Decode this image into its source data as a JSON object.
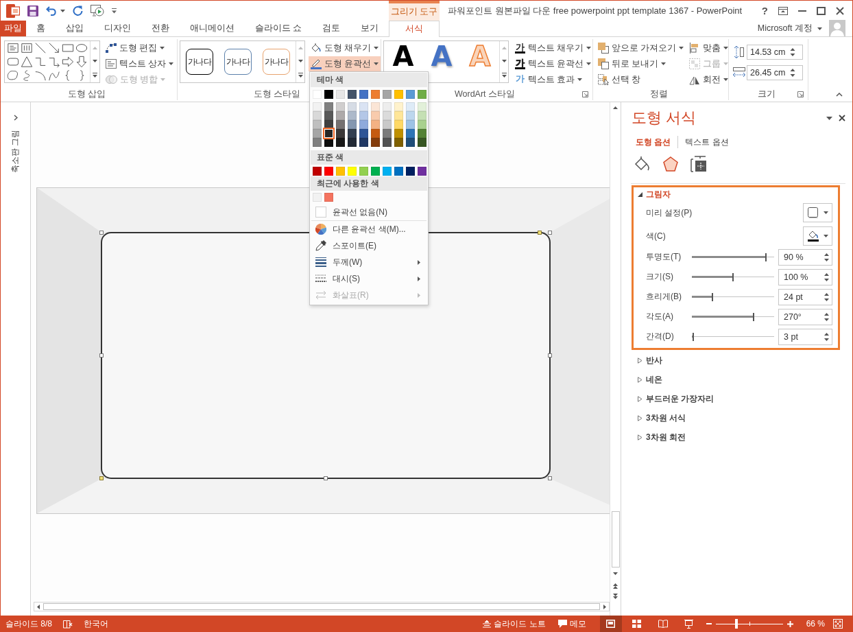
{
  "title_bar": {
    "context_label": "그리기 도구",
    "title": "파워포인트 원본파일 다운 free powerpoint ppt template 1367 - PowerPoint",
    "help": "?"
  },
  "tabs": [
    {
      "label": "파일",
      "kind": "file",
      "selected": false
    },
    {
      "label": "홈",
      "kind": "normal",
      "selected": false
    },
    {
      "label": "삽입",
      "kind": "normal",
      "selected": false
    },
    {
      "label": "디자인",
      "kind": "normal",
      "selected": false
    },
    {
      "label": "전환",
      "kind": "normal",
      "selected": false
    },
    {
      "label": "애니메이션",
      "kind": "normal",
      "selected": false
    },
    {
      "label": "슬라이드 쇼",
      "kind": "normal",
      "selected": false
    },
    {
      "label": "검토",
      "kind": "normal",
      "selected": false
    },
    {
      "label": "보기",
      "kind": "normal",
      "selected": false
    },
    {
      "label": "서식",
      "kind": "contextual",
      "selected": true
    }
  ],
  "account": {
    "label": "Microsoft 계정"
  },
  "ribbon": {
    "shape_insert": {
      "label": "도형 삽입",
      "commands": [
        {
          "label": "도형 편집",
          "disabled": false
        },
        {
          "label": "텍스트 상자",
          "disabled": false
        },
        {
          "label": "도형 병합",
          "disabled": true
        }
      ]
    },
    "shape_styles": {
      "label": "도형 스타일",
      "samples": [
        {
          "text": "가나다",
          "color": "#000000"
        },
        {
          "text": "가나다",
          "color": "#5b80ab"
        },
        {
          "text": "가나다",
          "color": "#e8a36e"
        }
      ],
      "commands": [
        {
          "label": "도형 채우기",
          "expanded": false
        },
        {
          "label": "도형 윤곽선",
          "expanded": true
        }
      ]
    },
    "wordart_styles": {
      "label": "WordArt 스타일",
      "samples": [
        {
          "text": "A",
          "kind": "solid",
          "color": "#000000"
        },
        {
          "text": "A",
          "kind": "shadow",
          "color": "#4472c4"
        },
        {
          "text": "A",
          "kind": "outline",
          "color": "#ed7d31"
        }
      ],
      "commands": [
        {
          "label": "텍스트 채우기",
          "icon_text": "가"
        },
        {
          "label": "텍스트 윤곽선",
          "icon_text": "가"
        },
        {
          "label": "텍스트 효과",
          "icon_text": "가"
        }
      ]
    },
    "arrange": {
      "label": "정렬",
      "commands": [
        {
          "label": "앞으로 가져오기",
          "kind": "dropdown",
          "disabled": false
        },
        {
          "label": "뒤로 보내기",
          "kind": "dropdown",
          "disabled": false
        },
        {
          "label": "선택 창",
          "kind": "button",
          "disabled": false
        },
        {
          "label": "맞춤",
          "kind": "dropdown",
          "disabled": false
        },
        {
          "label": "그룹",
          "kind": "dropdown",
          "disabled": true
        },
        {
          "label": "회전",
          "kind": "dropdown",
          "disabled": false
        }
      ]
    },
    "size": {
      "label": "크기",
      "height": "14.53 cm",
      "width": "26.45 cm"
    }
  },
  "color_menu": {
    "theme_header": "테마 색",
    "theme_colors": [
      {
        "color": "#ffffff",
        "selected": false,
        "shades": [
          {
            "color": "#f2f2f2",
            "selected": false
          },
          {
            "color": "#d9d9d9",
            "selected": false
          },
          {
            "color": "#bfbfbf",
            "selected": false
          },
          {
            "color": "#a6a6a6",
            "selected": false
          },
          {
            "color": "#808080",
            "selected": false
          }
        ]
      },
      {
        "color": "#000000",
        "selected": false,
        "shades": [
          {
            "color": "#808080",
            "selected": false
          },
          {
            "color": "#595959",
            "selected": false
          },
          {
            "color": "#404040",
            "selected": false
          },
          {
            "color": "#262626",
            "selected": true
          },
          {
            "color": "#0d0d0d",
            "selected": false
          }
        ]
      },
      {
        "color": "#e7e6e6",
        "selected": false,
        "shades": [
          {
            "color": "#d0cece",
            "selected": false
          },
          {
            "color": "#aeaaaa",
            "selected": false
          },
          {
            "color": "#757171",
            "selected": false
          },
          {
            "color": "#3b3838",
            "selected": false
          },
          {
            "color": "#171717",
            "selected": false
          }
        ]
      },
      {
        "color": "#44546a",
        "selected": false,
        "shades": [
          {
            "color": "#d6dce5",
            "selected": false
          },
          {
            "color": "#adb9ca",
            "selected": false
          },
          {
            "color": "#8497b0",
            "selected": false
          },
          {
            "color": "#333f50",
            "selected": false
          },
          {
            "color": "#222a35",
            "selected": false
          }
        ]
      },
      {
        "color": "#4472c4",
        "selected": false,
        "shades": [
          {
            "color": "#dae3f3",
            "selected": false
          },
          {
            "color": "#b4c7e7",
            "selected": false
          },
          {
            "color": "#8faadc",
            "selected": false
          },
          {
            "color": "#2f5597",
            "selected": false
          },
          {
            "color": "#203864",
            "selected": false
          }
        ]
      },
      {
        "color": "#ed7d31",
        "selected": false,
        "shades": [
          {
            "color": "#fbe5d6",
            "selected": false
          },
          {
            "color": "#f8cbad",
            "selected": false
          },
          {
            "color": "#f4b183",
            "selected": false
          },
          {
            "color": "#c55a11",
            "selected": false
          },
          {
            "color": "#843c0c",
            "selected": false
          }
        ]
      },
      {
        "color": "#a5a5a5",
        "selected": false,
        "shades": [
          {
            "color": "#ededed",
            "selected": false
          },
          {
            "color": "#dbdbdb",
            "selected": false
          },
          {
            "color": "#c9c9c9",
            "selected": false
          },
          {
            "color": "#7b7b7b",
            "selected": false
          },
          {
            "color": "#525252",
            "selected": false
          }
        ]
      },
      {
        "color": "#ffc000",
        "selected": false,
        "shades": [
          {
            "color": "#fff2cc",
            "selected": false
          },
          {
            "color": "#ffe699",
            "selected": false
          },
          {
            "color": "#ffd966",
            "selected": false
          },
          {
            "color": "#bf9000",
            "selected": false
          },
          {
            "color": "#7f6000",
            "selected": false
          }
        ]
      },
      {
        "color": "#5b9bd5",
        "selected": false,
        "shades": [
          {
            "color": "#deebf7",
            "selected": false
          },
          {
            "color": "#bdd7ee",
            "selected": false
          },
          {
            "color": "#9dc3e6",
            "selected": false
          },
          {
            "color": "#2e75b6",
            "selected": false
          },
          {
            "color": "#1f4e79",
            "selected": false
          }
        ]
      },
      {
        "color": "#70ad47",
        "selected": false,
        "shades": [
          {
            "color": "#e2f0d9",
            "selected": false
          },
          {
            "color": "#c5e0b4",
            "selected": false
          },
          {
            "color": "#a9d18e",
            "selected": false
          },
          {
            "color": "#548235",
            "selected": false
          },
          {
            "color": "#385723",
            "selected": false
          }
        ]
      }
    ],
    "standard_header": "표준 색",
    "standard_colors": [
      {
        "color": "#c00000",
        "selected": false
      },
      {
        "color": "#ff0000",
        "selected": false
      },
      {
        "color": "#ffc000",
        "selected": false
      },
      {
        "color": "#ffff00",
        "selected": false
      },
      {
        "color": "#92d050",
        "selected": false
      },
      {
        "color": "#00b050",
        "selected": false
      },
      {
        "color": "#00b0f0",
        "selected": false
      },
      {
        "color": "#0070c0",
        "selected": false
      },
      {
        "color": "#002060",
        "selected": false
      },
      {
        "color": "#7030a0",
        "selected": false
      }
    ],
    "recent_header": "최근에 사용한 색",
    "recent_colors": [
      {
        "color": "#f2f2f2",
        "selected": false
      },
      {
        "color": "#f4735f",
        "selected": false
      }
    ],
    "items": [
      {
        "label": "윤곽선 없음(N)",
        "disabled": false,
        "submenu": false
      },
      {
        "label": "다른 윤곽선 색(M)...",
        "disabled": false,
        "submenu": false
      },
      {
        "label": "스포이트(E)",
        "disabled": false,
        "submenu": false
      },
      {
        "label": "두께(W)",
        "disabled": false,
        "submenu": true
      },
      {
        "label": "대시(S)",
        "disabled": false,
        "submenu": true
      },
      {
        "label": "화살표(R)",
        "disabled": true,
        "submenu": true
      }
    ]
  },
  "thumbnail_pane": {
    "label": "축소판 그림"
  },
  "slide": {
    "shape_selected": true
  },
  "format_pane": {
    "title": "도형 서식",
    "tabs": [
      {
        "label": "도형 옵션",
        "selected": true
      },
      {
        "label": "텍스트 옵션",
        "selected": false
      }
    ],
    "icon_tabs": [
      {
        "selected": false
      },
      {
        "selected": true
      },
      {
        "selected": false
      }
    ],
    "sections": [
      {
        "label": "그림자",
        "expanded": true,
        "highlighted": true,
        "rows": [
          {
            "kind": "preset",
            "label": "미리 설정(P)"
          },
          {
            "kind": "color",
            "label": "색(C)",
            "color": "#000000"
          },
          {
            "kind": "slider",
            "label": "투명도(T)",
            "level": 0.9,
            "value": "90 %"
          },
          {
            "kind": "slider",
            "label": "크기(S)",
            "level": 0.5,
            "value": "100 %"
          },
          {
            "kind": "slider",
            "label": "흐리게(B)",
            "level": 0.25,
            "value": "24 pt"
          },
          {
            "kind": "slider",
            "label": "각도(A)",
            "level": 0.75,
            "value": "270°"
          },
          {
            "kind": "slider",
            "label": "간격(D)",
            "level": 0.02,
            "value": "3 pt"
          }
        ]
      },
      {
        "label": "반사",
        "expanded": false,
        "highlighted": false
      },
      {
        "label": "네온",
        "expanded": false,
        "highlighted": false
      },
      {
        "label": "부드러운 가장자리",
        "expanded": false,
        "highlighted": false
      },
      {
        "label": "3차원 서식",
        "expanded": false,
        "highlighted": false
      },
      {
        "label": "3차원 회전",
        "expanded": false,
        "highlighted": false
      }
    ]
  },
  "status_bar": {
    "slide": "슬라이드 8/8",
    "language": "한국어",
    "notes": "슬라이드 노트",
    "comments": "메모",
    "views": [
      {
        "selected": true
      },
      {
        "selected": false
      },
      {
        "selected": false
      },
      {
        "selected": false
      }
    ],
    "zoom_slider": {
      "level": 0.31
    },
    "zoom": "66 %"
  }
}
